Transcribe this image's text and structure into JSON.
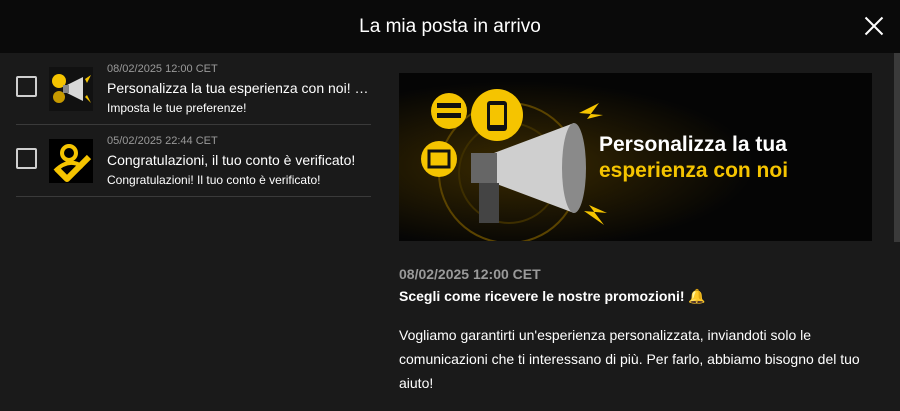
{
  "header": {
    "title": "La mia posta in arrivo"
  },
  "messages": [
    {
      "date": "08/02/2025 12:00 CET",
      "title": "Personalizza la tua esperienza con noi! 👉",
      "subtitle": "Imposta le tue preferenze!",
      "icon": "megaphone-thumbnail"
    },
    {
      "date": "05/02/2025 22:44 CET",
      "title": "Congratulazioni, il tuo conto è verificato!",
      "subtitle": "Congratulazioni! Il tuo conto è verificato!",
      "icon": "verified-user-icon"
    }
  ],
  "detail": {
    "banner": {
      "line1": "Personalizza la tua",
      "line2": "esperienza con noi"
    },
    "date": "08/02/2025 12:00 CET",
    "subject": "Scegli come ricevere le nostre promozioni! 🔔",
    "body": "Vogliamo garantirti un'esperienza personalizzata, inviandoti solo le comunicazioni che ti interessano di più. Per farlo, abbiamo bisogno del tuo aiuto!"
  },
  "colors": {
    "accent": "#f5c400",
    "background": "#1a1a1a",
    "header": "#0a0a0a"
  }
}
